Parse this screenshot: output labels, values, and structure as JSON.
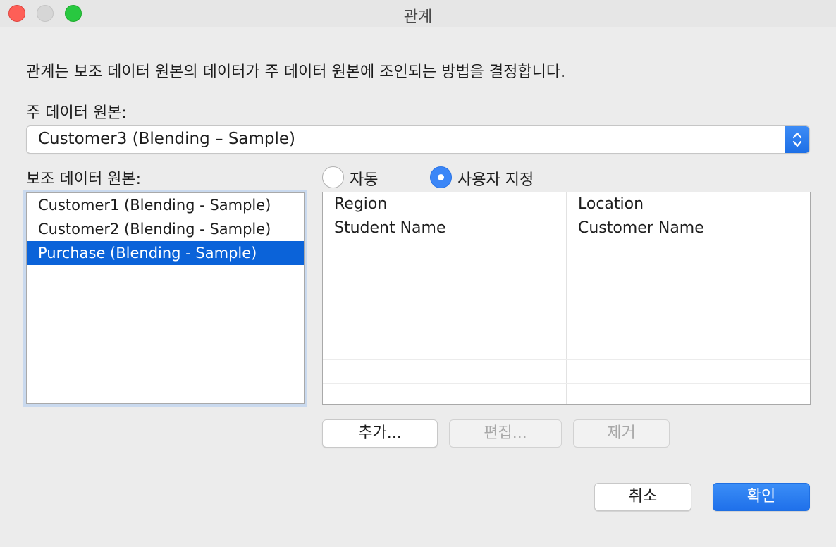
{
  "window": {
    "title": "관계"
  },
  "description": "관계는 보조 데이터 원본의 데이터가 주 데이터 원본에 조인되는 방법을 결정합니다.",
  "primary": {
    "label": "주 데이터 원본:",
    "selected": "Customer3 (Blending – Sample)"
  },
  "secondary": {
    "label": "보조 데이터 원본:",
    "items": [
      {
        "label": "Customer1 (Blending - Sample)",
        "selected": false
      },
      {
        "label": "Customer2 (Blending - Sample)",
        "selected": false
      },
      {
        "label": "Purchase (Blending - Sample)",
        "selected": true
      }
    ]
  },
  "mode": {
    "auto_label": "자동",
    "custom_label": "사용자 지정",
    "selected": "custom"
  },
  "mappings": [
    {
      "primary_field": "Region",
      "secondary_field": "Location"
    },
    {
      "primary_field": "Student Name",
      "secondary_field": "Customer Name"
    }
  ],
  "buttons": {
    "add": "추가...",
    "edit": "편집...",
    "remove": "제거",
    "cancel": "취소",
    "ok": "확인"
  },
  "colors": {
    "accent": "#3b86f7",
    "selection": "#0b63d9"
  }
}
